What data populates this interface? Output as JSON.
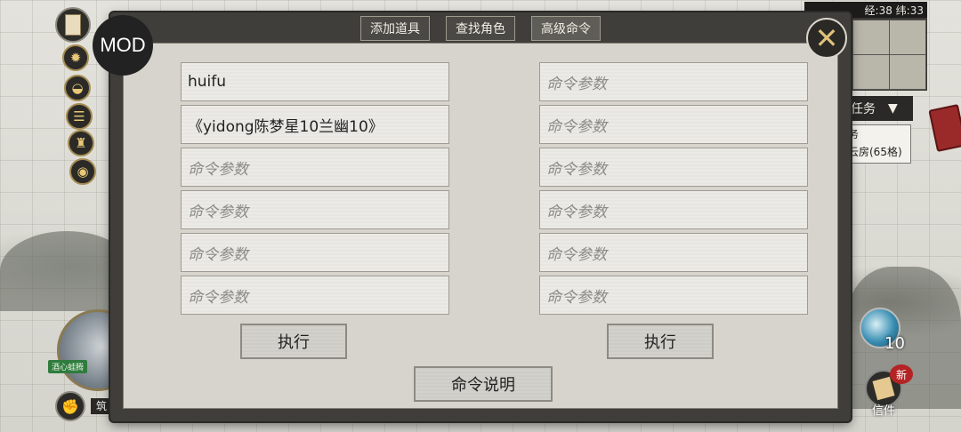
{
  "modal": {
    "tabs": [
      {
        "label": "添加道具"
      },
      {
        "label": "查找角色"
      },
      {
        "label": "高级命令"
      }
    ],
    "active_tab": "高级命令",
    "mod_label": "MOD",
    "left_fields": [
      {
        "value": "huifu",
        "placeholder": ""
      },
      {
        "value": "《yidong陈梦星10兰幽10》",
        "placeholder": ""
      },
      {
        "value": "",
        "placeholder": "命令参数"
      },
      {
        "value": "",
        "placeholder": "命令参数"
      },
      {
        "value": "",
        "placeholder": "命令参数"
      },
      {
        "value": "",
        "placeholder": "命令参数"
      }
    ],
    "right_fields": [
      {
        "value": "",
        "placeholder": "命令参数"
      },
      {
        "value": "",
        "placeholder": "命令参数"
      },
      {
        "value": "",
        "placeholder": "命令参数"
      },
      {
        "value": "",
        "placeholder": "命令参数"
      },
      {
        "value": "",
        "placeholder": "命令参数"
      },
      {
        "value": "",
        "placeholder": "命令参数"
      }
    ],
    "execute_left_label": "执行",
    "execute_right_label": "执行",
    "help_label": "命令说明"
  },
  "hud": {
    "top_status": "经:38 纬:33",
    "task_label": "任务",
    "task_info_line1": "务",
    "task_info_line2": "云房(65格)",
    "yinyang_count": "10",
    "mail_badge": "新",
    "mail_label": "信件",
    "hero_tag": "酒心蛙腾",
    "bottom_name": "筑"
  },
  "icons": [
    "book-icon",
    "mod-icon",
    "fire-icon",
    "scroll-icon",
    "fist-icon",
    "close-icon",
    "yinyang-icon",
    "mail-icon",
    "chevron-down-icon"
  ]
}
